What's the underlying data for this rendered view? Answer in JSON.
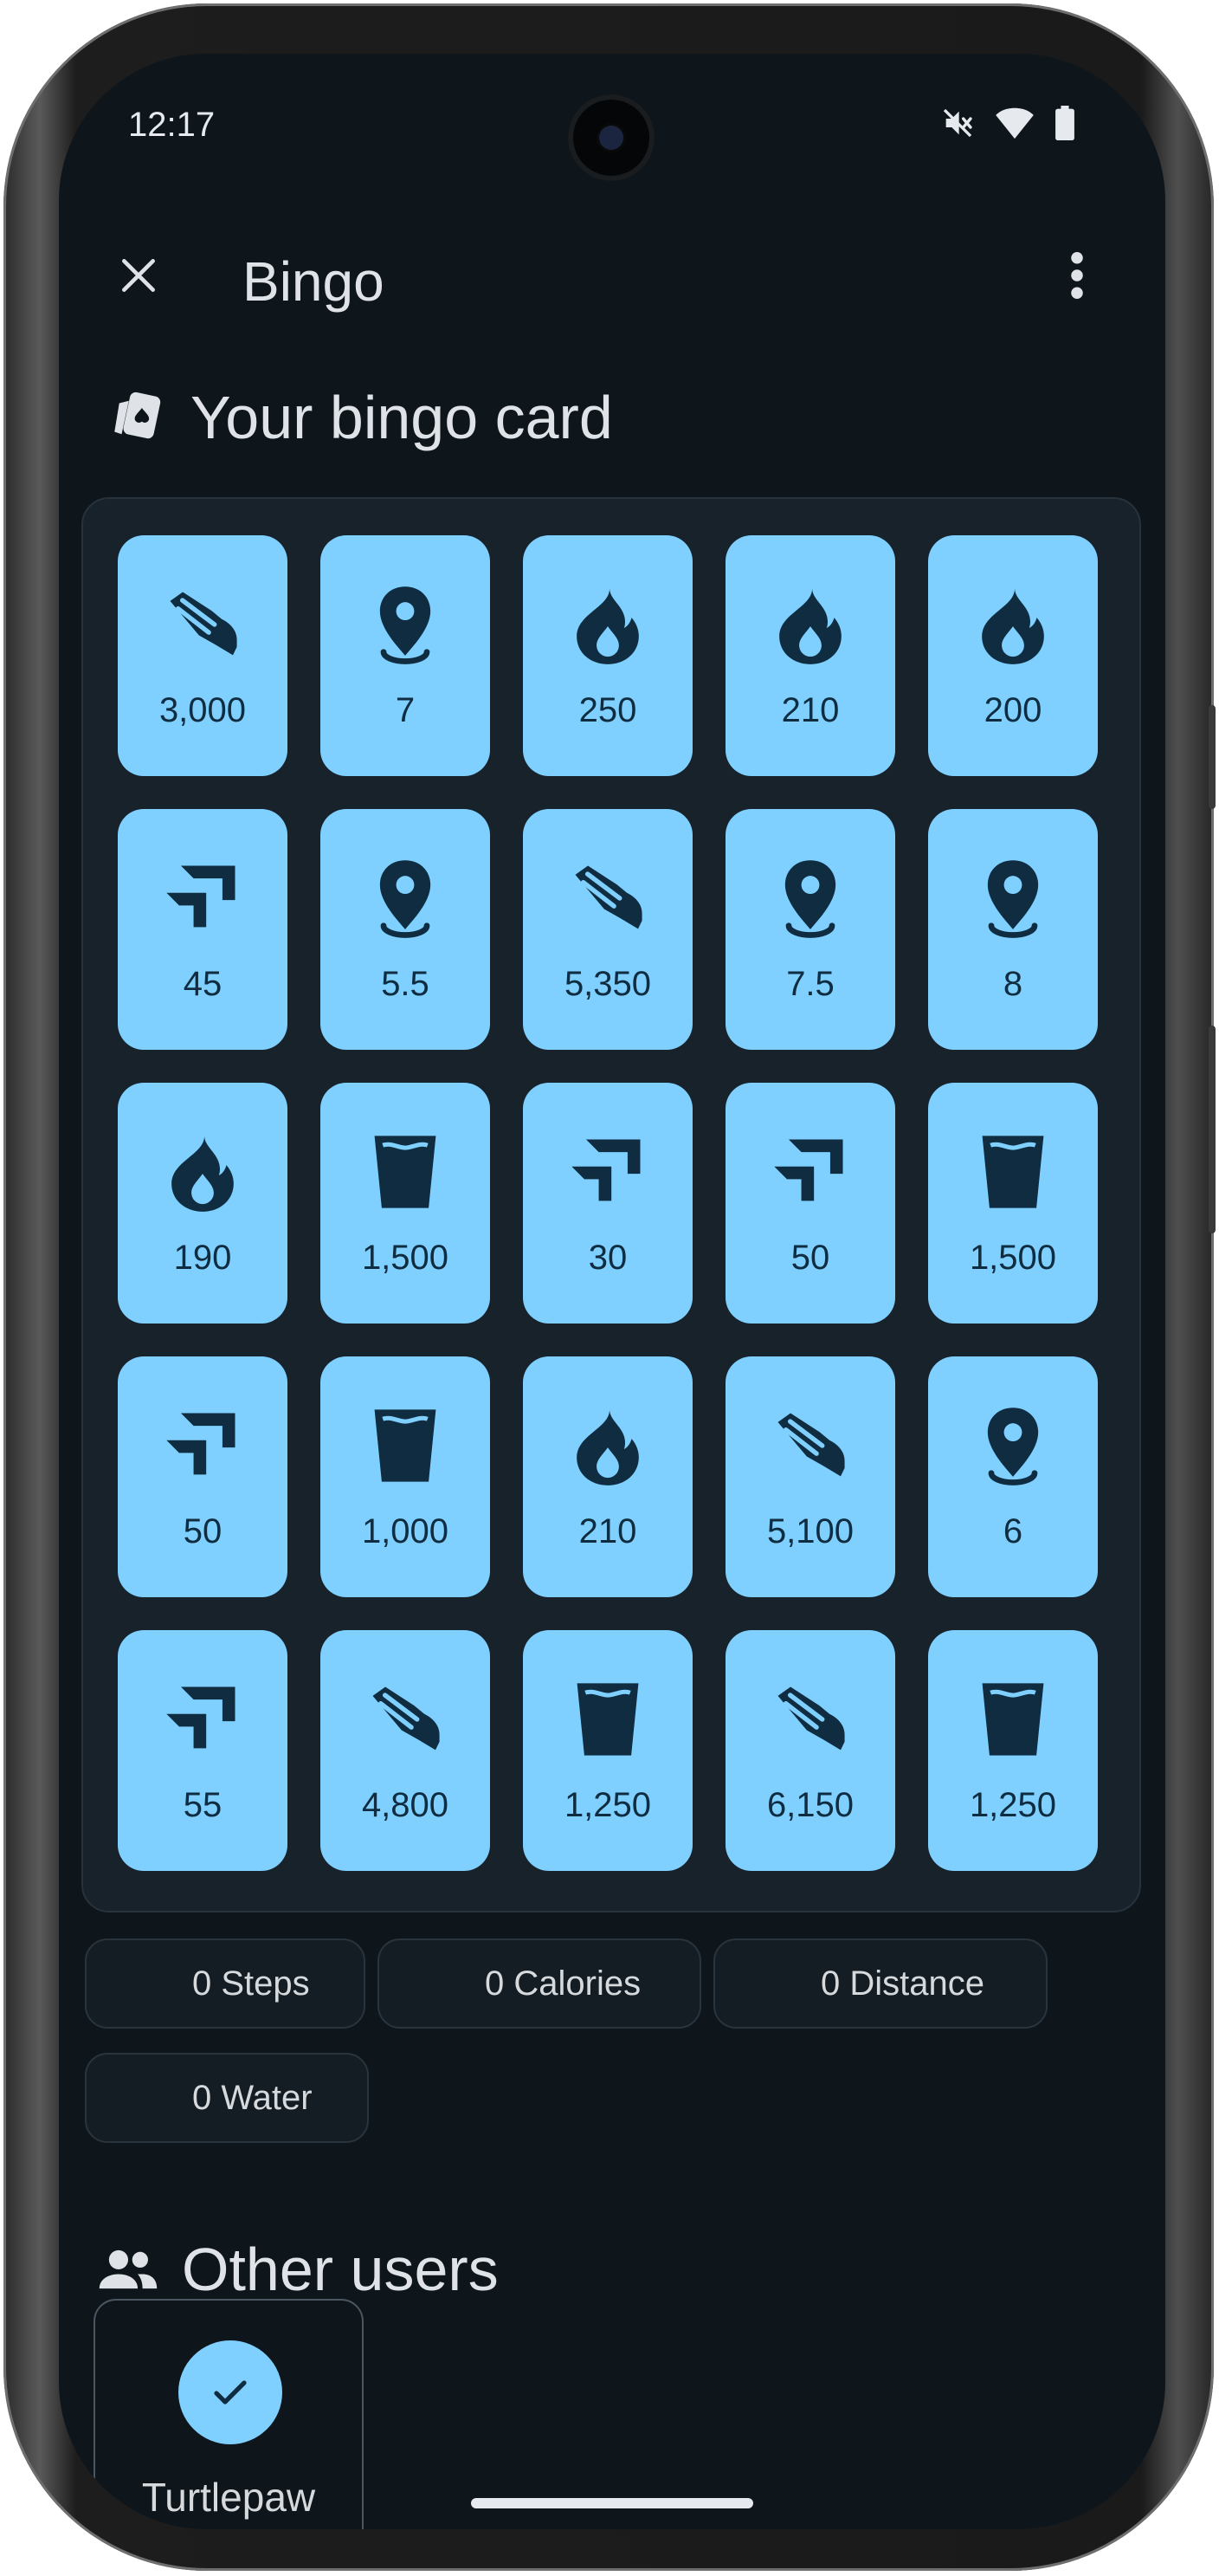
{
  "status_bar": {
    "time": "12:17"
  },
  "app_bar": {
    "title": "Bingo"
  },
  "bingo_section": {
    "title": "Your bingo card"
  },
  "bingo_card": [
    [
      {
        "icon": "shoe-icon",
        "value": "3,000"
      },
      {
        "icon": "location-pin-icon",
        "value": "7"
      },
      {
        "icon": "flame-icon",
        "value": "250"
      },
      {
        "icon": "flame-icon",
        "value": "210"
      },
      {
        "icon": "flame-icon",
        "value": "200"
      }
    ],
    [
      {
        "icon": "stairs-icon",
        "value": "45"
      },
      {
        "icon": "location-pin-icon",
        "value": "5.5"
      },
      {
        "icon": "shoe-icon",
        "value": "5,350"
      },
      {
        "icon": "location-pin-icon",
        "value": "7.5"
      },
      {
        "icon": "location-pin-icon",
        "value": "8"
      }
    ],
    [
      {
        "icon": "flame-icon",
        "value": "190"
      },
      {
        "icon": "water-glass-icon",
        "value": "1,500"
      },
      {
        "icon": "stairs-icon",
        "value": "30"
      },
      {
        "icon": "stairs-icon",
        "value": "50"
      },
      {
        "icon": "water-glass-icon",
        "value": "1,500"
      }
    ],
    [
      {
        "icon": "stairs-icon",
        "value": "50"
      },
      {
        "icon": "water-glass-icon",
        "value": "1,000"
      },
      {
        "icon": "flame-icon",
        "value": "210"
      },
      {
        "icon": "shoe-icon",
        "value": "5,100"
      },
      {
        "icon": "location-pin-icon",
        "value": "6"
      }
    ],
    [
      {
        "icon": "stairs-icon",
        "value": "55"
      },
      {
        "icon": "shoe-icon",
        "value": "4,800"
      },
      {
        "icon": "water-glass-icon",
        "value": "1,250"
      },
      {
        "icon": "shoe-icon",
        "value": "6,150"
      },
      {
        "icon": "water-glass-icon",
        "value": "1,250"
      }
    ]
  ],
  "stat_chips": [
    {
      "icon": "shoe-icon",
      "label": "0 Steps"
    },
    {
      "icon": "flame-icon",
      "label": "0 Calories"
    },
    {
      "icon": "location-pin-icon",
      "label": "0 Distance"
    },
    {
      "icon": "water-glass-icon",
      "label": "0 Water"
    }
  ],
  "other_users_section": {
    "title": "Other users"
  },
  "other_users": [
    {
      "name": "Turtlepaw"
    }
  ],
  "colors": {
    "background": "#0e161c",
    "tile": "#7fd0ff",
    "tile_icon": "#0f2c40",
    "text": "#dfe3e7"
  }
}
